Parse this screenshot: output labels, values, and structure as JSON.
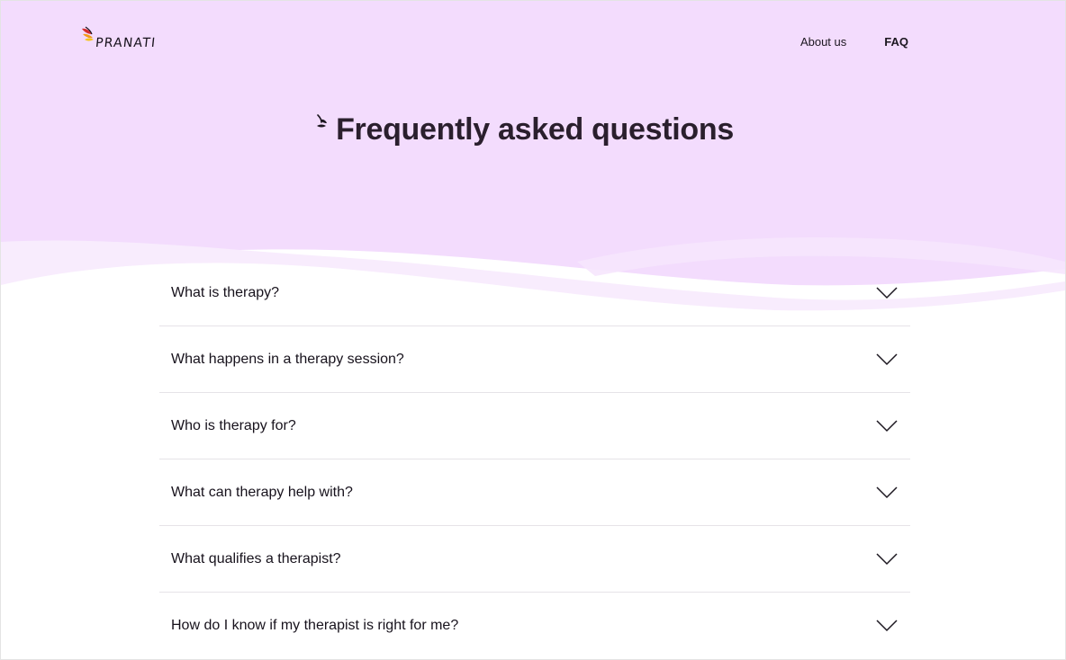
{
  "brand": {
    "name": "PRANATI",
    "logo_icon": "flower-petals-icon",
    "petal_colors": [
      "#d62e2e",
      "#f29b1a",
      "#f5c51d",
      "#1c1720"
    ]
  },
  "nav": {
    "items": [
      {
        "label": "About us",
        "active": false
      },
      {
        "label": "FAQ",
        "active": true
      }
    ]
  },
  "page": {
    "title": "Frequently asked questions",
    "hero_color": "#f3dcfd",
    "wave_color": "#f8ecfd"
  },
  "faq": {
    "items": [
      {
        "question": "What is therapy?",
        "icon": "chevron-down-icon",
        "expanded": false
      },
      {
        "question": "What happens in a therapy session?",
        "icon": "chevron-down-icon",
        "expanded": false
      },
      {
        "question": "Who is therapy for?",
        "icon": "chevron-down-icon",
        "expanded": false
      },
      {
        "question": "What can therapy help with?",
        "icon": "chevron-down-icon",
        "expanded": false
      },
      {
        "question": "What qualifies a therapist?",
        "icon": "chevron-down-icon",
        "expanded": false
      },
      {
        "question": "How do I know if my therapist is right for me?",
        "icon": "chevron-down-icon",
        "expanded": false
      }
    ]
  }
}
